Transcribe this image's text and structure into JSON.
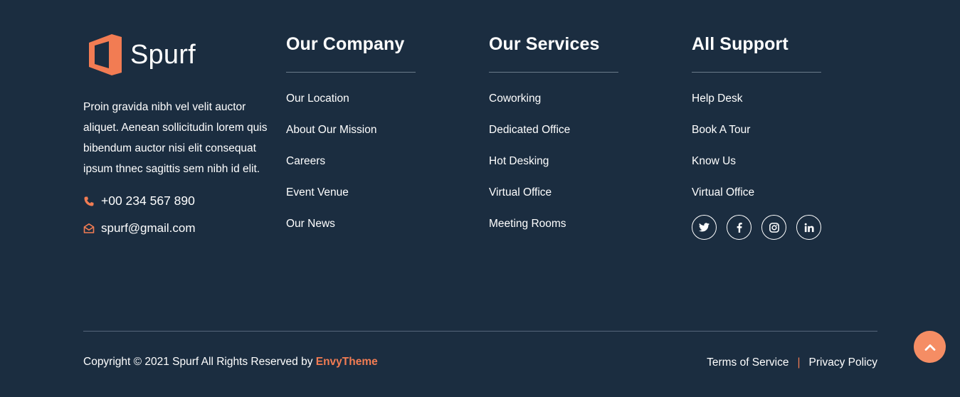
{
  "brand": {
    "name": "Spurf",
    "about": "Proin gravida nibh vel velit auctor aliquet. Aenean sollicitudin lorem quis bibendum auctor nisi elit consequat ipsum thnec sagittis sem nibh id elit.",
    "phone": "+00 234 567 890",
    "email": "spurf@gmail.com",
    "accent_color": "#f27c53"
  },
  "columns": [
    {
      "title": "Our Company",
      "links": [
        "Our Location",
        "About Our Mission",
        "Careers",
        "Event Venue",
        "Our News"
      ]
    },
    {
      "title": "Our Services",
      "links": [
        "Coworking",
        "Dedicated Office",
        "Hot Desking",
        "Virtual Office",
        "Meeting Rooms"
      ]
    },
    {
      "title": "All Support",
      "links": [
        "Help Desk",
        "Book A Tour",
        "Know Us",
        "Virtual Office"
      ]
    }
  ],
  "social": [
    "twitter-icon",
    "facebook-icon",
    "instagram-icon",
    "linkedin-icon"
  ],
  "bottom": {
    "copyright_prefix": "Copyright © 2021 Spurf All Rights Reserved by ",
    "copyright_brand": "EnvyTheme",
    "terms": "Terms of Service",
    "separator": "|",
    "privacy": "Privacy Policy"
  },
  "back_to_top_icon": "chevron-up-icon"
}
